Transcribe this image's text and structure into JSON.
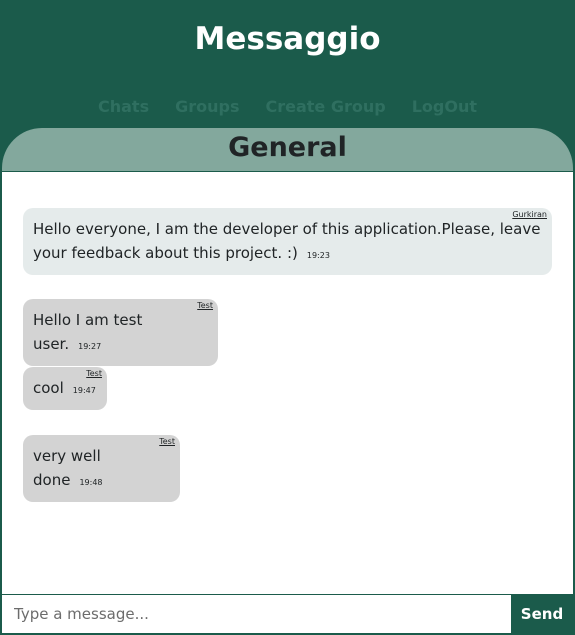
{
  "app": {
    "title": "Messaggio"
  },
  "nav": {
    "items": [
      {
        "label": "Chats"
      },
      {
        "label": "Groups"
      },
      {
        "label": "Create Group"
      },
      {
        "label": "LogOut"
      }
    ]
  },
  "room": {
    "title": "General"
  },
  "messages": [
    {
      "user": "Gurkiran",
      "text": "Hello everyone, I am the developer of this application.Please, leave your feedback about this project. :)",
      "time": "19:23"
    },
    {
      "user": "Test",
      "text": "Hello I am test user.",
      "time": "19:27"
    },
    {
      "user": "Test",
      "text": "cool",
      "time": "19:47"
    },
    {
      "user": "Test",
      "text": "very well done",
      "time": "19:48"
    }
  ],
  "composer": {
    "placeholder": "Type a message...",
    "send_label": "Send"
  },
  "colors": {
    "primary": "#1b5b4b",
    "tab": "#83a89d",
    "bubble": "#d3d3d3",
    "bubble_first": "#e5ebeb"
  }
}
